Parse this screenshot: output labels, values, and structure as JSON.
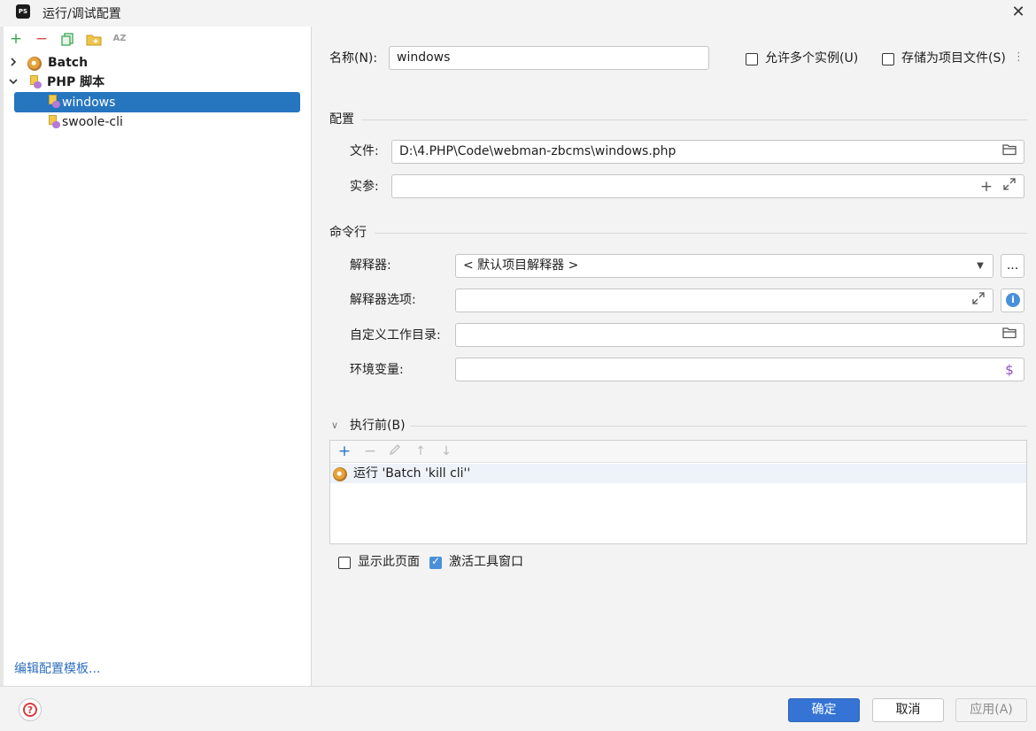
{
  "window": {
    "title": "运行/调试配置",
    "app_icon_text": "PS",
    "close_glyph": "✕"
  },
  "toolbar": {
    "add": "+",
    "remove": "−",
    "copy_icon": "copy-icon",
    "folder_icon": "folder-icon",
    "sort_label": "AZ"
  },
  "tree": {
    "items": [
      {
        "label": "Batch",
        "icon": "batch-config-icon",
        "expanded": false,
        "bold": true
      },
      {
        "label": "PHP 脚本",
        "icon": "php-script-icon",
        "expanded": true,
        "bold": true
      },
      {
        "label": "windows",
        "icon": "php-file-icon",
        "selected": true
      },
      {
        "label": "swoole-cli",
        "icon": "php-file-icon"
      }
    ],
    "edit_templates": "编辑配置模板..."
  },
  "form": {
    "name_label": "名称(N):",
    "name_value": "windows",
    "allow_multiple_label": "允许多个实例(U)",
    "allow_multiple_checked": false,
    "store_as_project_label": "存储为项目文件(S)",
    "store_as_project_checked": false,
    "config_section": "配置",
    "file_label": "文件:",
    "file_value": "D:\\4.PHP\\Code\\webman-zbcms\\windows.php",
    "args_label": "实参:",
    "args_value": "",
    "cmdline_section": "命令行",
    "interpreter_label": "解释器:",
    "interpreter_value": "< 默认项目解释器 >",
    "interpreter_more": "...",
    "interpreter_options_label": "解释器选项:",
    "interpreter_options_value": "",
    "workdir_label": "自定义工作目录:",
    "workdir_value": "",
    "env_label": "环境变量:",
    "env_value": "",
    "before_section": "执行前(B)",
    "before_tasks": [
      {
        "label": "运行 'Batch 'kill cli''",
        "icon": "batch-config-icon"
      }
    ],
    "show_page_label": "显示此页面",
    "show_page_checked": false,
    "activate_tool_window_label": "激活工具窗口",
    "activate_tool_window_checked": true
  },
  "buttons": {
    "ok": "确定",
    "cancel": "取消",
    "apply": "应用(A)"
  },
  "colors": {
    "accent": "#3574d4",
    "selection": "#2675bf",
    "add_green": "#3aa655",
    "remove_red": "#d94b4b",
    "link": "#2f6fbf"
  }
}
